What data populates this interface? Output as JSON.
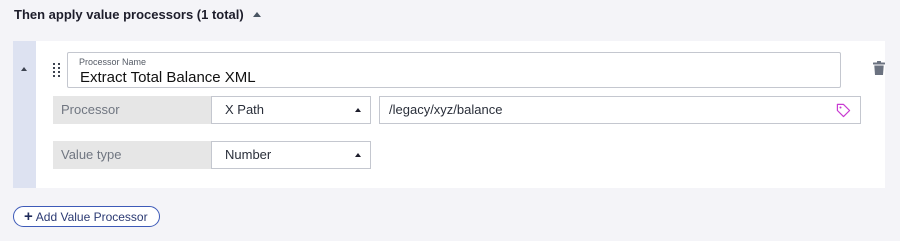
{
  "section": {
    "title": "Then apply value processors (1 total)"
  },
  "processor": {
    "name_label": "Processor Name",
    "name_value": "Extract Total Balance XML",
    "processor_label": "Processor",
    "processor_type": "X Path",
    "xpath_value": "/legacy/xyz/balance",
    "value_type_label": "Value type",
    "value_type": "Number"
  },
  "actions": {
    "add_label": "Add Value Processor"
  },
  "icons": {
    "collapse": "caret-up-icon",
    "drag": "drag-handle-icon",
    "delete": "trash-icon",
    "tag": "tag-icon",
    "add": "plus-icon"
  },
  "colors": {
    "accent": "#3d5ab8",
    "tag": "#c83bd1",
    "rail": "#dde2f1",
    "page_bg": "#f4f4f8"
  }
}
